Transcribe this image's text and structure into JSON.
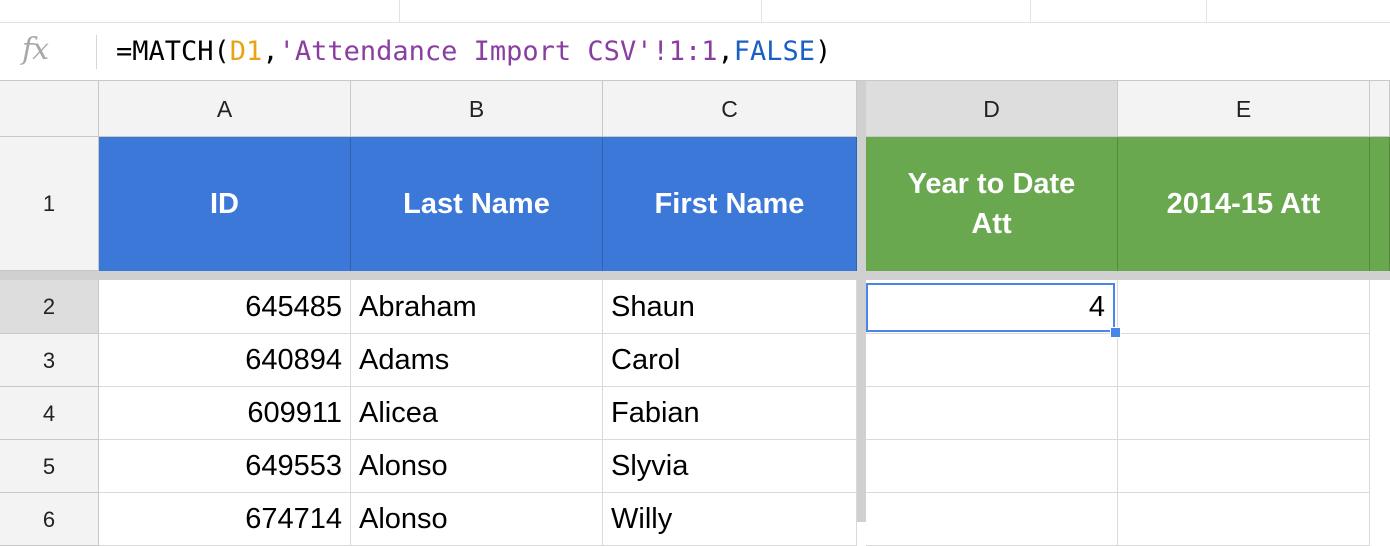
{
  "formula": {
    "prefix": "=MATCH(",
    "ref": "D1",
    "comma1": ",",
    "string": "'Attendance Import CSV'!1:1",
    "comma2": ",",
    "bool": "FALSE",
    "suffix": ")"
  },
  "columns": [
    "A",
    "B",
    "C",
    "D",
    "E"
  ],
  "rows": [
    "1",
    "2",
    "3",
    "4",
    "5",
    "6"
  ],
  "headers": {
    "a": "ID",
    "b": "Last Name",
    "c": "First Name",
    "d_line1": "Year to Date",
    "d_line2": "Att",
    "e": "2014-15 Att"
  },
  "data": [
    {
      "id": "645485",
      "last": "Abraham",
      "first": "Shaun",
      "ytd": "4"
    },
    {
      "id": "640894",
      "last": "Adams",
      "first": "Carol",
      "ytd": ""
    },
    {
      "id": "609911",
      "last": "Alicea",
      "first": "Fabian",
      "ytd": ""
    },
    {
      "id": "649553",
      "last": "Alonso",
      "first": "Slyvia",
      "ytd": ""
    },
    {
      "id": "674714",
      "last": "Alonso",
      "first": "Willy",
      "ytd": ""
    }
  ],
  "colors": {
    "header_blue": "#3c78d8",
    "header_green": "#6aa84f",
    "selection": "#4a86e8"
  }
}
